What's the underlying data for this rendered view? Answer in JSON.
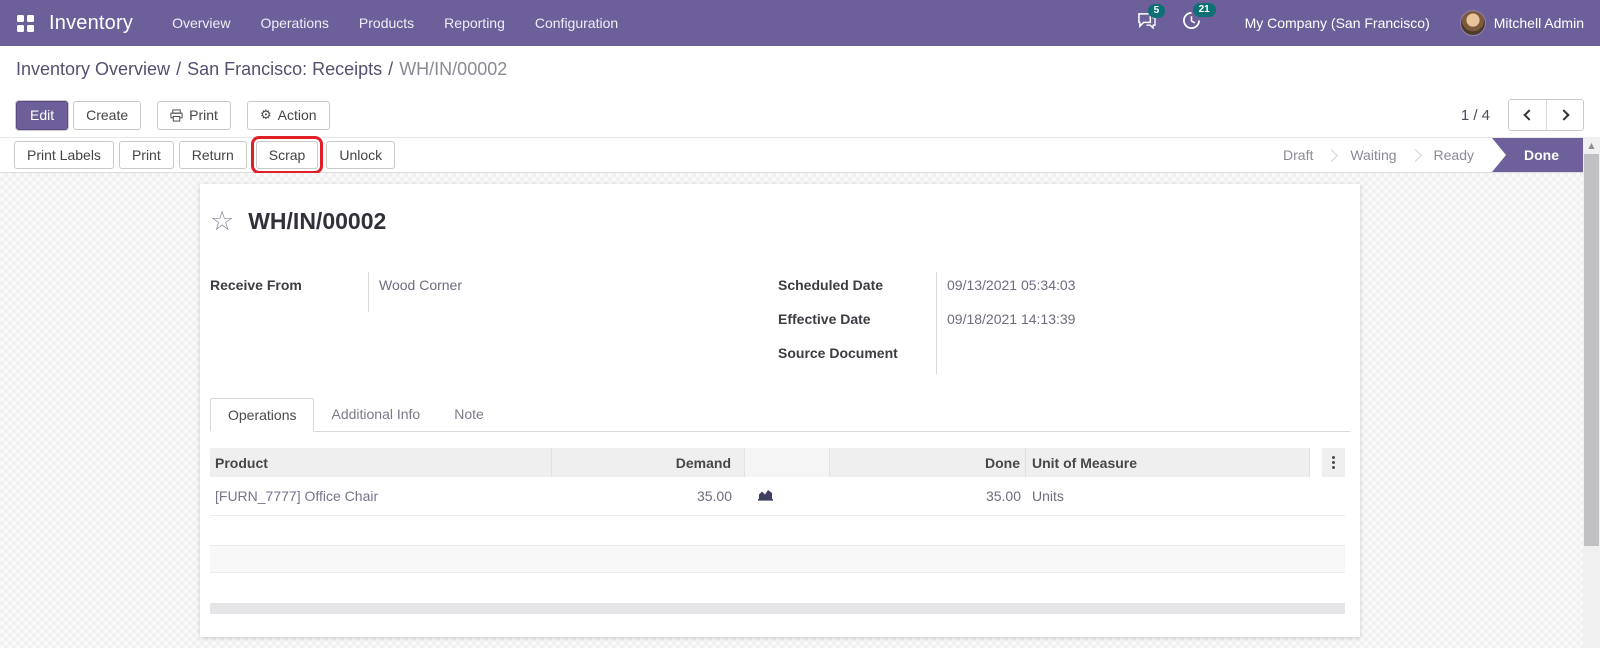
{
  "nav": {
    "brand": "Inventory",
    "items": [
      "Overview",
      "Operations",
      "Products",
      "Reporting",
      "Configuration"
    ],
    "messages_badge": "5",
    "activities_badge": "21",
    "company": "My Company (San Francisco)",
    "user": "Mitchell Admin"
  },
  "breadcrumb": {
    "links": [
      "Inventory Overview",
      "San Francisco: Receipts"
    ],
    "current": "WH/IN/00002",
    "separator": "/"
  },
  "control": {
    "edit": "Edit",
    "create": "Create",
    "print": "Print",
    "action": "Action",
    "pager_count": "1 / 4"
  },
  "statusbar": {
    "buttons": [
      "Print Labels",
      "Print",
      "Return",
      "Scrap",
      "Unlock"
    ],
    "highlighted_button": "Scrap",
    "stages": [
      "Draft",
      "Waiting",
      "Ready",
      "Done"
    ],
    "active_stage": "Done"
  },
  "form": {
    "title": "WH/IN/00002",
    "left_fields": [
      {
        "label": "Receive From",
        "value": "Wood Corner"
      }
    ],
    "right_fields": [
      {
        "label": "Scheduled Date",
        "value": "09/13/2021 05:34:03"
      },
      {
        "label": "Effective Date",
        "value": "09/18/2021 14:13:39"
      },
      {
        "label": "Source Document",
        "value": ""
      }
    ],
    "tabs": [
      "Operations",
      "Additional Info",
      "Note"
    ],
    "table": {
      "headers": {
        "product": "Product",
        "demand": "Demand",
        "done": "Done",
        "uom": "Unit of Measure"
      },
      "rows": [
        {
          "product": "[FURN_7777] Office Chair",
          "demand": "35.00",
          "done": "35.00",
          "uom": "Units"
        }
      ]
    }
  },
  "colors": {
    "nav_bar": "#6d609a",
    "badge": "#0c7075",
    "done_stage": "#6e619b",
    "scrap_highlight": "#e11f26"
  }
}
